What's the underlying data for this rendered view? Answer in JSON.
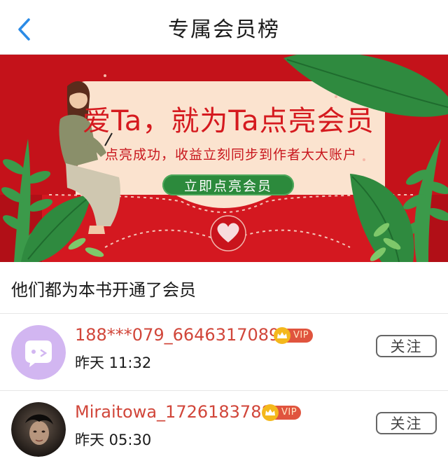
{
  "header": {
    "title": "专属会员榜",
    "back_icon": "chevron-left-icon",
    "accent": "#2b8be6"
  },
  "banner": {
    "title": "爱Ta，就为Ta点亮会员",
    "subtitle": "点亮成功，收益立刻同步到作者大大账户",
    "cta_label": "立即点亮会员",
    "colors": {
      "red": "#c4121a",
      "card": "#fbe3cf",
      "green": "#2c8a3c"
    }
  },
  "section": {
    "title": "他们都为本书开通了会员"
  },
  "members": [
    {
      "username": "188***079_6646317089",
      "badge": "VIP",
      "time": "昨天 11:32",
      "follow_label": "关注",
      "avatar_icon": "chat-bubble-avatar-icon"
    },
    {
      "username": "Miraitowa_1726183788",
      "badge": "VIP",
      "time": "昨天 05:30",
      "follow_label": "关注",
      "avatar_icon": "photo-avatar"
    }
  ]
}
